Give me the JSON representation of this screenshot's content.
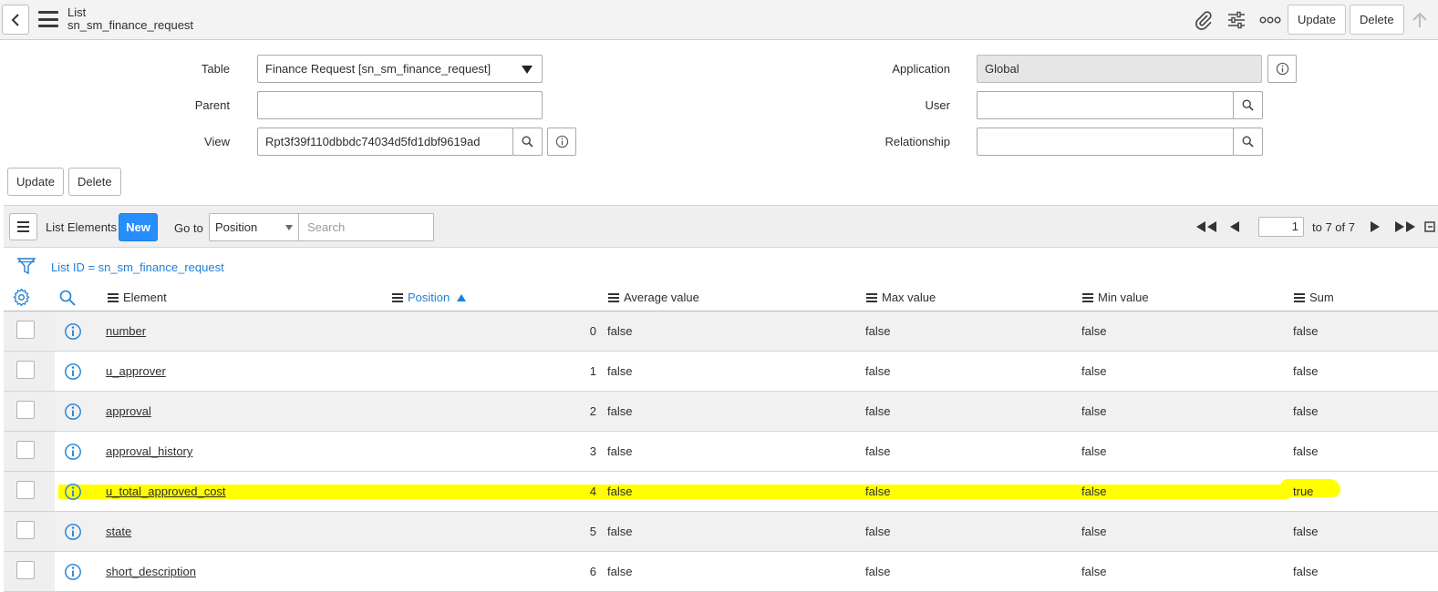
{
  "header": {
    "title": "List",
    "subtitle": "sn_sm_finance_request",
    "update_label": "Update",
    "delete_label": "Delete"
  },
  "form": {
    "table_label": "Table",
    "table_value": "Finance Request [sn_sm_finance_request]",
    "parent_label": "Parent",
    "parent_value": "",
    "view_label": "View",
    "view_value": "Rpt3f39f110dbbdc74034d5fd1dbf9619ad",
    "application_label": "Application",
    "application_value": "Global",
    "user_label": "User",
    "user_value": "",
    "relationship_label": "Relationship",
    "relationship_value": ""
  },
  "actions": {
    "update_label": "Update",
    "delete_label": "Delete"
  },
  "list": {
    "title": "List Elements",
    "new_label": "New",
    "goto_label": "Go to",
    "goto_field": "Position",
    "search_placeholder": "Search",
    "page_value": "1",
    "page_text": "to 7 of 7",
    "breadcrumb": "List ID = sn_sm_finance_request"
  },
  "columns": {
    "element": "Element",
    "position": "Position",
    "average": "Average value",
    "max": "Max value",
    "min": "Min value",
    "sum": "Sum"
  },
  "rows": [
    {
      "element": "number",
      "position": "0",
      "average": "false",
      "max": "false",
      "min": "false",
      "sum": "false"
    },
    {
      "element": "u_approver",
      "position": "1",
      "average": "false",
      "max": "false",
      "min": "false",
      "sum": "false"
    },
    {
      "element": "approval",
      "position": "2",
      "average": "false",
      "max": "false",
      "min": "false",
      "sum": "false"
    },
    {
      "element": "approval_history",
      "position": "3",
      "average": "false",
      "max": "false",
      "min": "false",
      "sum": "false"
    },
    {
      "element": "u_total_approved_cost",
      "position": "4",
      "average": "false",
      "max": "false",
      "min": "false",
      "sum": "true"
    },
    {
      "element": "state",
      "position": "5",
      "average": "false",
      "max": "false",
      "min": "false",
      "sum": "false"
    },
    {
      "element": "short_description",
      "position": "6",
      "average": "false",
      "max": "false",
      "min": "false",
      "sum": "false"
    }
  ],
  "colors": {
    "accent": "#278efc",
    "link": "#1f7fd6",
    "highlight": "#ffff00"
  },
  "icons": [
    "chevron-left-icon",
    "hamburger-icon",
    "paperclip-icon",
    "sliders-icon",
    "more-icon",
    "arrow-up-icon",
    "search-icon",
    "info-icon",
    "filter-icon",
    "gear-icon",
    "first-page-icon",
    "prev-page-icon",
    "next-page-icon",
    "last-page-icon"
  ]
}
